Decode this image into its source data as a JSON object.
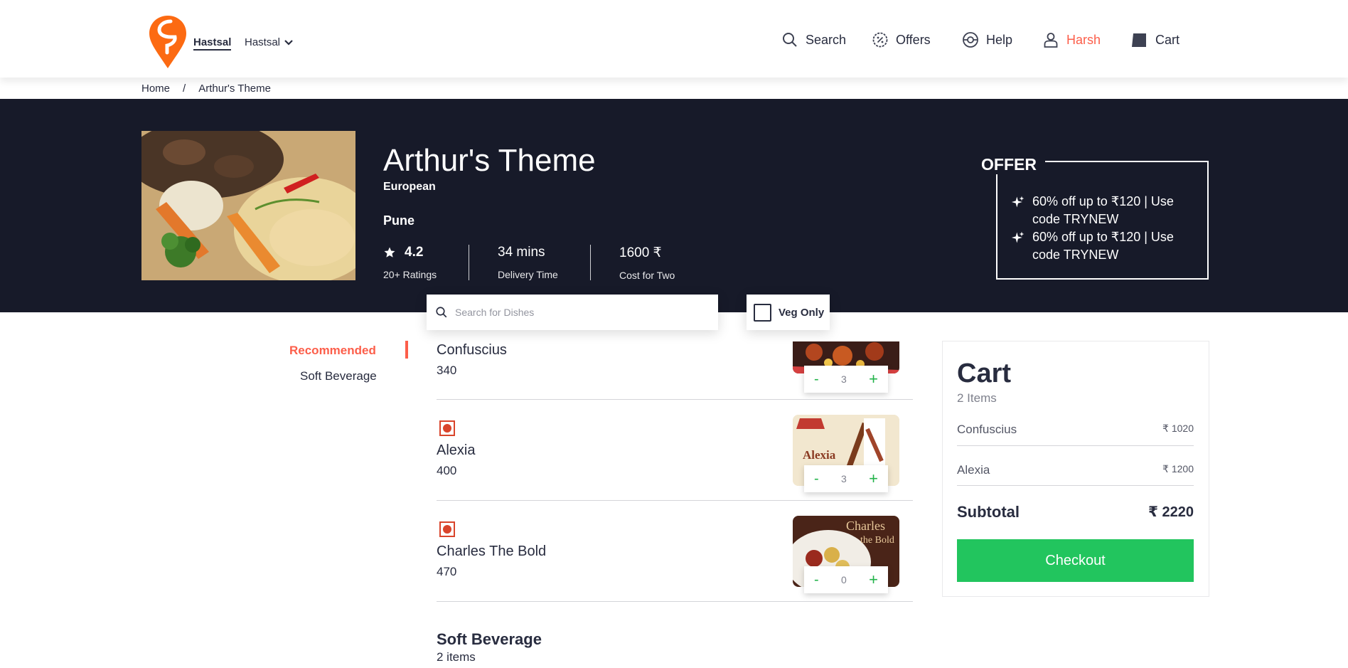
{
  "header": {
    "location_main": "Hastsal",
    "location_sub": "Hastsal",
    "nav": {
      "search": "Search",
      "offers": "Offers",
      "help": "Help",
      "user": "Harsh",
      "cart": "Cart"
    }
  },
  "breadcrumb": {
    "home": "Home",
    "separator": "/",
    "current": "Arthur's Theme"
  },
  "restaurant": {
    "name": "Arthur's Theme",
    "cuisine": "European",
    "city": "Pune",
    "rating": "4.2",
    "ratings_label": "20+ Ratings",
    "delivery_time": "34 mins",
    "delivery_label": "Delivery Time",
    "cost": "1600 ₹",
    "cost_label": "Cost for Two"
  },
  "offer": {
    "title": "OFFER",
    "items": [
      "60% off up to ₹120 | Use code TRYNEW",
      "60% off up to ₹120 | Use code TRYNEW"
    ]
  },
  "search": {
    "placeholder": "Search for Dishes",
    "veg_only": "Veg Only"
  },
  "categories": {
    "active": "Recommended",
    "other": "Soft Beverage"
  },
  "menu": [
    {
      "name": "Confuscius",
      "price": "340",
      "qty": "3"
    },
    {
      "name": "Alexia",
      "price": "400",
      "qty": "3"
    },
    {
      "name": "Charles The Bold",
      "price": "470",
      "qty": "0"
    }
  ],
  "stepper": {
    "minus": "-",
    "plus": "+"
  },
  "section": {
    "title": "Soft Beverage",
    "count": "2 items"
  },
  "cart": {
    "title": "Cart",
    "count": "2 Items",
    "rows": [
      {
        "name": "Confuscius",
        "price": "₹ 1020"
      },
      {
        "name": "Alexia",
        "price": "₹ 1200"
      }
    ],
    "subtotal_label": "Subtotal",
    "subtotal_value": "₹ 2220",
    "checkout": "Checkout"
  },
  "colors": {
    "brand": "#fc8019",
    "banner": "#171a29",
    "accent_red": "#fc5e4a",
    "checkout_green": "#22c55e"
  }
}
